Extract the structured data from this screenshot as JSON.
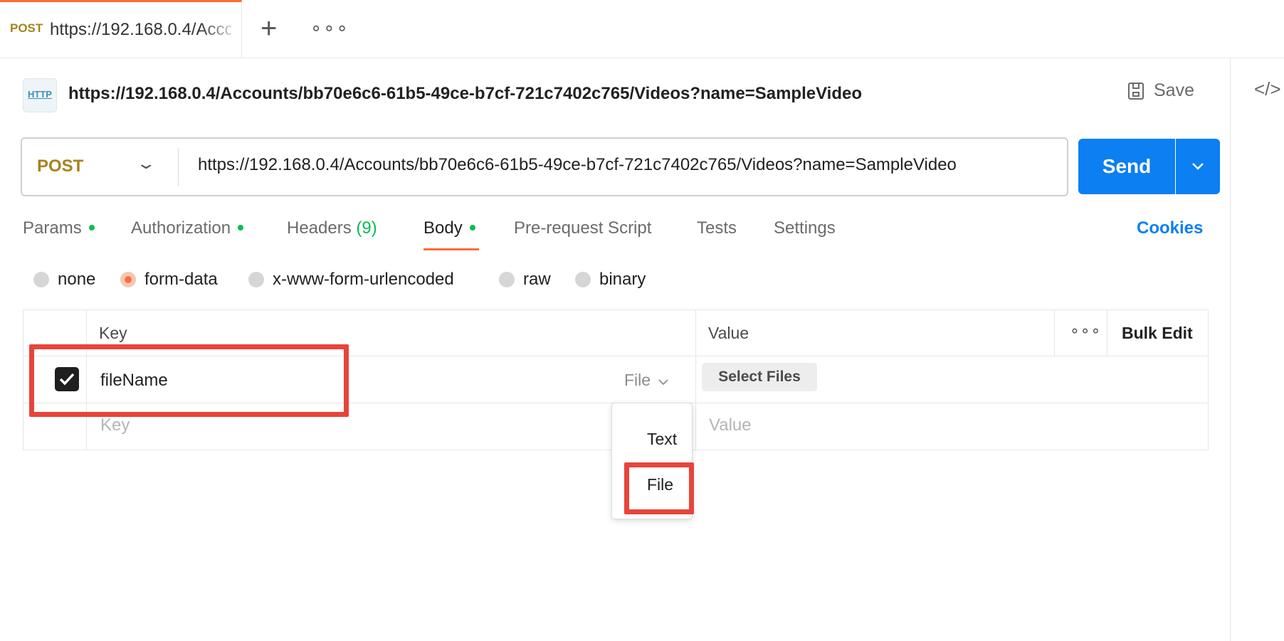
{
  "tabs": {
    "active": {
      "method": "POST",
      "url": "https://192.168.0.4/Accounts/bb70e6c6-61b5-49ce-b7cf-721c7402c765/Videos?name=SampleVideo"
    },
    "new_tab_icon": "plus-icon",
    "more_icon": "more-horizontal-icon"
  },
  "request": {
    "icon": "http-icon",
    "title": "https://192.168.0.4/Accounts/bb70e6c6-61b5-49ce-b7cf-721c7402c765/Videos?name=SampleVideo",
    "save_label": "Save",
    "method": "POST",
    "url": "https://192.168.0.4/Accounts/bb70e6c6-61b5-49ce-b7cf-721c7402c765/Videos?name=SampleVideo",
    "send_label": "Send"
  },
  "request_tabs": [
    {
      "label": "Params",
      "dot": true
    },
    {
      "label": "Authorization",
      "dot": true
    },
    {
      "label": "Headers",
      "count": "(9)"
    },
    {
      "label": "Body",
      "dot": true,
      "active": true
    },
    {
      "label": "Pre-request Script"
    },
    {
      "label": "Tests"
    },
    {
      "label": "Settings"
    }
  ],
  "cookies_label": "Cookies",
  "body_modes": [
    {
      "label": "none",
      "selected": false
    },
    {
      "label": "form-data",
      "selected": true
    },
    {
      "label": "x-www-form-urlencoded",
      "selected": false
    },
    {
      "label": "raw",
      "selected": false
    },
    {
      "label": "binary",
      "selected": false
    }
  ],
  "table": {
    "headers": {
      "key": "Key",
      "value": "Value",
      "bulk_edit": "Bulk Edit"
    },
    "rows": [
      {
        "checked": true,
        "key": "fileName",
        "type": "File",
        "value_button": "Select Files"
      }
    ],
    "empty_row": {
      "key_placeholder": "Key",
      "value_placeholder": "Value"
    }
  },
  "type_dropdown": {
    "options": [
      "Text",
      "File"
    ],
    "highlighted": "File"
  },
  "colors": {
    "accent_orange": "#ff6c37",
    "send_blue": "#0c7ff2",
    "status_green": "#0cbb52",
    "method_post": "#a7831e",
    "highlight_red": "#e8443a"
  }
}
